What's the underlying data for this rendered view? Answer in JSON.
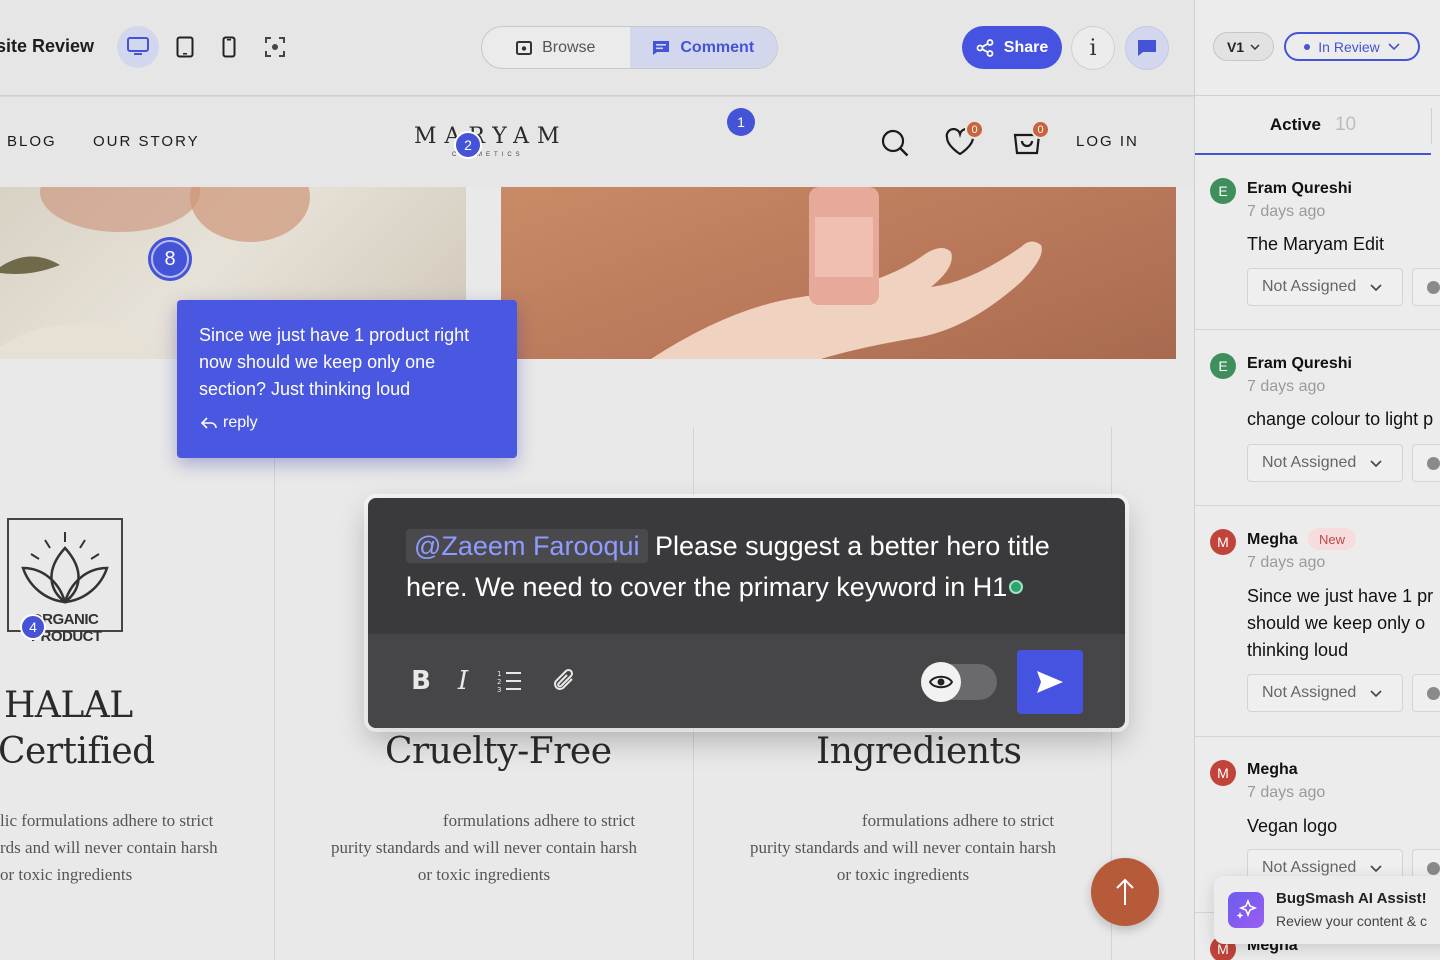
{
  "toolbar": {
    "title": "site Review",
    "devices": [
      "desktop-icon",
      "tablet-icon",
      "mobile-icon",
      "screenshot-icon"
    ],
    "mode_browse": "Browse",
    "mode_comment": "Comment",
    "share_label": "Share",
    "info_label": "i"
  },
  "site": {
    "nav_links": [
      "BLOG",
      "OUR STORY"
    ],
    "logo": "MARYAM",
    "logo_sub": "COSMETICS",
    "wishlist_count": "0",
    "cart_count": "0",
    "login": "LOG IN",
    "pins": [
      "1",
      "2",
      "8",
      "4"
    ],
    "organic_badge": "ORGANIC PRODUCT",
    "features": [
      {
        "title_line1": "HALAL",
        "title_line2": "Certified",
        "text_line1": "lic formulations adhere to strict",
        "text_line2": "rds and will never contain harsh",
        "text_line3": "or toxic ingredients"
      },
      {
        "title_line1": "Cruelty-Free",
        "text_line1": "formulations adhere to strict",
        "text_line2": "purity standards and will never contain harsh",
        "text_line3": "or toxic ingredients"
      },
      {
        "title_line1": "Ingredients",
        "text_line1": "formulations adhere to strict",
        "text_line2": "purity standards and will never contain harsh",
        "text_line3": "or toxic ingredients"
      }
    ]
  },
  "comment_bubble": {
    "text": "Since we just have 1 product right now should we keep only one section? Just thinking loud",
    "reply": "reply"
  },
  "composer": {
    "mention": "@Zaeem Farooqui",
    "text": "Please suggest a better hero title here. We need to cover the primary keyword in H1"
  },
  "sidebar": {
    "version": "V1",
    "status": "In Review",
    "tab_label": "Active",
    "tab_count": "10",
    "comments": [
      {
        "initial": "E",
        "name": "Eram Qureshi",
        "time": "7 days ago",
        "lines": [
          "The Maryam Edit"
        ],
        "assignee": "Not Assigned",
        "color": "#3f8f5c"
      },
      {
        "initial": "E",
        "name": "Eram Qureshi",
        "time": "7 days ago",
        "lines": [
          "change colour to light p"
        ],
        "assignee": "Not Assigned",
        "color": "#3f8f5c"
      },
      {
        "initial": "M",
        "name": "Megha",
        "badge": "New",
        "time": "7 days ago",
        "lines": [
          "Since we just have 1 pr",
          "should we keep only o",
          "thinking loud"
        ],
        "assignee": "Not Assigned",
        "color": "#c0443a"
      },
      {
        "initial": "M",
        "name": "Megha",
        "time": "7 days ago",
        "lines": [
          "Vegan logo"
        ],
        "assignee": "Not Assigned",
        "color": "#c0443a"
      },
      {
        "initial": "M",
        "name": "Megha"
      }
    ]
  },
  "ai_assist": {
    "title": "BugSmash AI Assist!",
    "subtitle": "Review your content & c"
  },
  "colors": {
    "accent": "#4553e0",
    "brand_orange": "#b75a3a"
  }
}
